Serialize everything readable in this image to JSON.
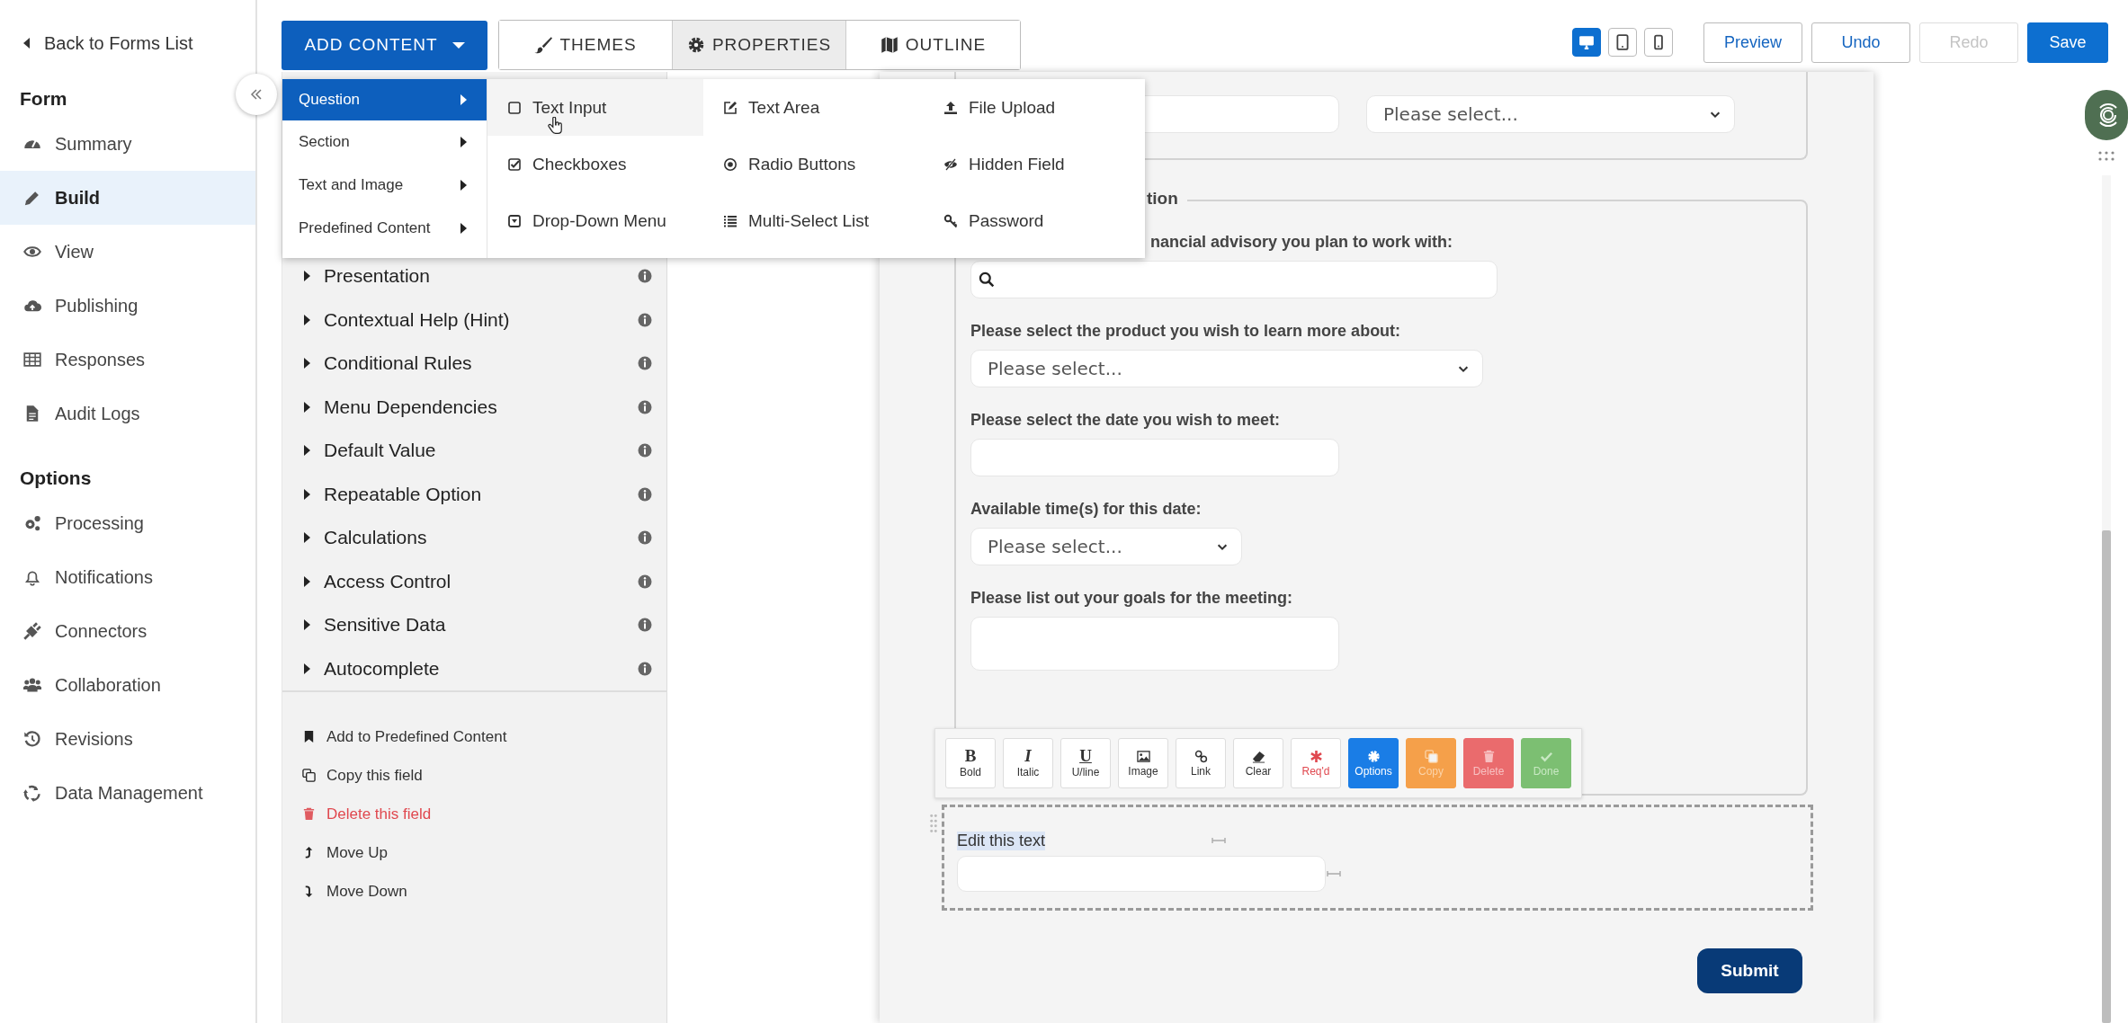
{
  "sidebar": {
    "back_link": "Back to Forms List",
    "sections": [
      {
        "title": "Form",
        "items": [
          {
            "label": "Summary",
            "selected": false
          },
          {
            "label": "Build",
            "selected": true
          },
          {
            "label": "View",
            "selected": false
          },
          {
            "label": "Publishing",
            "selected": false
          },
          {
            "label": "Responses",
            "selected": false
          },
          {
            "label": "Audit Logs",
            "selected": false
          }
        ]
      },
      {
        "title": "Options",
        "items": [
          {
            "label": "Processing",
            "selected": false
          },
          {
            "label": "Notifications",
            "selected": false
          },
          {
            "label": "Connectors",
            "selected": false
          },
          {
            "label": "Collaboration",
            "selected": false
          },
          {
            "label": "Revisions",
            "selected": false
          },
          {
            "label": "Data Management",
            "selected": false
          }
        ]
      }
    ]
  },
  "toolbar": {
    "add_content": "ADD CONTENT",
    "tabs": [
      {
        "label": "THEMES",
        "selected": false
      },
      {
        "label": "PROPERTIES",
        "selected": true
      },
      {
        "label": "OUTLINE",
        "selected": false
      }
    ],
    "devices": [
      {
        "kind": "desktop",
        "selected": true
      },
      {
        "kind": "tablet",
        "selected": false
      },
      {
        "kind": "phone",
        "selected": false
      }
    ],
    "buttons": [
      {
        "label": "Preview",
        "kind": "default",
        "disabled": false
      },
      {
        "label": "Undo",
        "kind": "default",
        "disabled": false
      },
      {
        "label": "Redo",
        "kind": "default",
        "disabled": true
      },
      {
        "label": "Save",
        "kind": "primary",
        "disabled": false
      }
    ]
  },
  "add_menu": {
    "items": [
      {
        "label": "Question",
        "selected": true
      },
      {
        "label": "Section",
        "selected": false
      },
      {
        "label": "Text and Image",
        "selected": false
      },
      {
        "label": "Predefined Content",
        "selected": false
      }
    ],
    "submenu": [
      {
        "label": "Text Input",
        "hovered": true
      },
      {
        "label": "Text Area",
        "hovered": false
      },
      {
        "label": "File Upload",
        "hovered": false
      },
      {
        "label": "Checkboxes",
        "hovered": false
      },
      {
        "label": "Radio Buttons",
        "hovered": false
      },
      {
        "label": "Hidden Field",
        "hovered": false
      },
      {
        "label": "Drop-Down Menu",
        "hovered": false
      },
      {
        "label": "Multi-Select List",
        "hovered": false
      },
      {
        "label": "Password",
        "hovered": false
      }
    ]
  },
  "properties": {
    "sections": [
      {
        "label": "Presentation"
      },
      {
        "label": "Contextual Help (Hint)"
      },
      {
        "label": "Conditional Rules"
      },
      {
        "label": "Menu Dependencies"
      },
      {
        "label": "Default Value"
      },
      {
        "label": "Repeatable Option"
      },
      {
        "label": "Calculations"
      },
      {
        "label": "Access Control"
      },
      {
        "label": "Sensitive Data"
      },
      {
        "label": "Autocomplete"
      }
    ],
    "actions": [
      {
        "label": "Add to Predefined Content",
        "kind": "normal"
      },
      {
        "label": "Copy this field",
        "kind": "normal"
      },
      {
        "label": "Delete this field",
        "kind": "danger"
      },
      {
        "label": "Move Up",
        "kind": "normal"
      },
      {
        "label": "Move Down",
        "kind": "normal"
      }
    ]
  },
  "form": {
    "top_select": {
      "value": "Please select..."
    },
    "legend": "tion",
    "fields": [
      {
        "kind": "search",
        "label": "nancial advisory you plan to work with:"
      },
      {
        "kind": "select",
        "label": "Please select the product you wish to learn more about:",
        "value": "Please select..."
      },
      {
        "kind": "text",
        "label": "Please select the date you wish to meet:"
      },
      {
        "kind": "select-short",
        "label": "Available time(s) for this date:",
        "value": "Please select..."
      },
      {
        "kind": "textarea",
        "label": "Please list out your goals for the meeting:"
      }
    ],
    "text_block": {
      "label": "Edit this text"
    },
    "submit": "Submit"
  },
  "editor_toolbar": [
    {
      "label": "Bold",
      "glyph": "B",
      "kind": "plain"
    },
    {
      "label": "Italic",
      "glyph": "I",
      "kind": "plain"
    },
    {
      "label": "U/line",
      "glyph": "U",
      "kind": "plain"
    },
    {
      "label": "Image",
      "kind": "plain"
    },
    {
      "label": "Link",
      "kind": "plain"
    },
    {
      "label": "Clear",
      "kind": "plain"
    },
    {
      "label": "Req'd",
      "kind": "required"
    },
    {
      "label": "Options",
      "kind": "primary"
    },
    {
      "label": "Copy",
      "kind": "copy"
    },
    {
      "label": "Delete",
      "kind": "delete"
    },
    {
      "label": "Done",
      "kind": "done"
    }
  ]
}
